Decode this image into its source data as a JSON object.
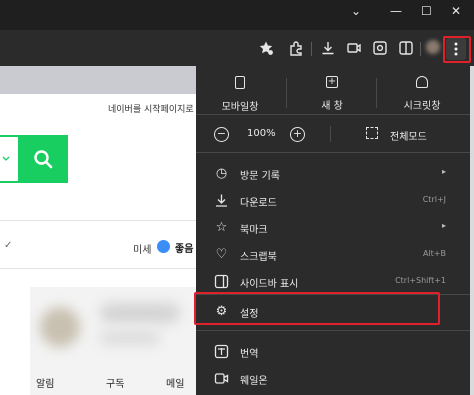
{
  "window": {
    "minimize": "—",
    "maximize": "☐",
    "close": "✕",
    "collapse": "⌄"
  },
  "page": {
    "start_link": "네이버를 시작페이지로",
    "dust_label": "미세",
    "dust_status": "좋음",
    "bottom_tabs": [
      "알림",
      "구독",
      "메일"
    ]
  },
  "menu": {
    "quick": [
      {
        "label": "모바일창",
        "icon": "mobile-window-icon"
      },
      {
        "label": "새 창",
        "icon": "new-window-icon"
      },
      {
        "label": "시크릿창",
        "icon": "secret-window-icon"
      }
    ],
    "zoom": {
      "minus": "−",
      "value": "100%",
      "plus": "+",
      "fullscreen": "전체모드"
    },
    "items": [
      {
        "label": "방문 기록",
        "icon": "history-icon",
        "shortcut": "",
        "submenu": true
      },
      {
        "label": "다운로드",
        "icon": "download-icon",
        "shortcut": "Ctrl+J",
        "submenu": false
      },
      {
        "label": "북마크",
        "icon": "star-icon",
        "shortcut": "",
        "submenu": true
      },
      {
        "label": "스크랩북",
        "icon": "scrapbook-icon",
        "shortcut": "Alt+B",
        "submenu": false
      },
      {
        "label": "사이드바 표시",
        "icon": "sidebar-icon",
        "shortcut": "Ctrl+Shift+1",
        "submenu": false
      },
      {
        "label": "설정",
        "icon": "gear-icon",
        "shortcut": "",
        "submenu": false
      },
      {
        "label": "번역",
        "icon": "translate-icon",
        "shortcut": "",
        "submenu": false
      },
      {
        "label": "웨일온",
        "icon": "whale-on-icon",
        "shortcut": "",
        "submenu": false
      }
    ],
    "arrow": "▸"
  },
  "colors": {
    "highlight": "#e0202a",
    "search_green": "#19ce60",
    "menu_bg": "#2b2b2b"
  }
}
